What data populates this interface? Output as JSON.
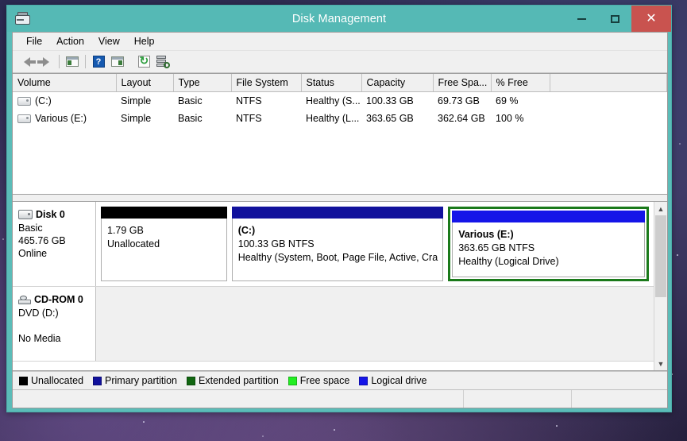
{
  "window": {
    "title": "Disk Management",
    "app_icon": "disk-drive-icon",
    "minimize_label": "",
    "maximize_label": "",
    "close_label": "✕"
  },
  "menubar": {
    "items": [
      {
        "label": "File"
      },
      {
        "label": "Action"
      },
      {
        "label": "View"
      },
      {
        "label": "Help"
      }
    ]
  },
  "toolbar": {
    "buttons": [
      {
        "name": "back-arrow-icon",
        "title": "Back"
      },
      {
        "name": "forward-arrow-icon",
        "title": "Forward"
      },
      {
        "name": "show-hide-console-tree-icon",
        "title": "Show/Hide Console Tree"
      },
      {
        "name": "help-icon",
        "title": "Help",
        "glyph": "?"
      },
      {
        "name": "show-hide-action-pane-icon",
        "title": "Show/Hide Action Pane"
      },
      {
        "name": "refresh-icon",
        "title": "Refresh"
      },
      {
        "name": "rescan-disks-icon",
        "title": "Rescan Disks"
      }
    ]
  },
  "volume_table": {
    "columns": [
      "Volume",
      "Layout",
      "Type",
      "File System",
      "Status",
      "Capacity",
      "Free Spa...",
      "% Free",
      ""
    ],
    "rows": [
      {
        "volume": "(C:)",
        "layout": "Simple",
        "type": "Basic",
        "file_system": "NTFS",
        "status": "Healthy (S...",
        "capacity": "100.33 GB",
        "free_space": "69.73 GB",
        "percent_free": "69 %"
      },
      {
        "volume": "Various (E:)",
        "layout": "Simple",
        "type": "Basic",
        "file_system": "NTFS",
        "status": "Healthy (L...",
        "capacity": "363.65 GB",
        "free_space": "362.64 GB",
        "percent_free": "100 %"
      }
    ]
  },
  "graphical_view": {
    "disks": [
      {
        "name": "Disk 0",
        "type": "Basic",
        "size": "465.76 GB",
        "status": "Online",
        "icon": "disk-drive-icon",
        "partitions": [
          {
            "title": "",
            "size": "1.79 GB",
            "status": "Unallocated",
            "detail": "",
            "bar_color": "#000000",
            "selected": false,
            "width_pct": 23
          },
          {
            "title": "(C:)",
            "size": "100.33 GB NTFS",
            "status": "Healthy (System, Boot, Page File, Active, Cra",
            "detail": "",
            "bar_color": "#11119c",
            "selected": false,
            "width_pct": 36
          },
          {
            "title": "Various  (E:)",
            "size": "363.65 GB NTFS",
            "status": "Healthy (Logical Drive)",
            "detail": "",
            "bar_color": "#1515e8",
            "selected": true,
            "width_pct": 41
          }
        ]
      },
      {
        "name": "CD-ROM 0",
        "type": "DVD (D:)",
        "size": "",
        "status": "No Media",
        "icon": "cd-rom-icon",
        "partitions": []
      }
    ]
  },
  "legend": {
    "items": [
      {
        "label": "Unallocated",
        "color": "#000000"
      },
      {
        "label": "Primary partition",
        "color": "#11119c"
      },
      {
        "label": "Extended partition",
        "color": "#116611"
      },
      {
        "label": "Free space",
        "color": "#22ee22"
      },
      {
        "label": "Logical drive",
        "color": "#1515e8"
      }
    ]
  },
  "statusbar": {
    "main": "",
    "cell1": "",
    "cell2": ""
  }
}
